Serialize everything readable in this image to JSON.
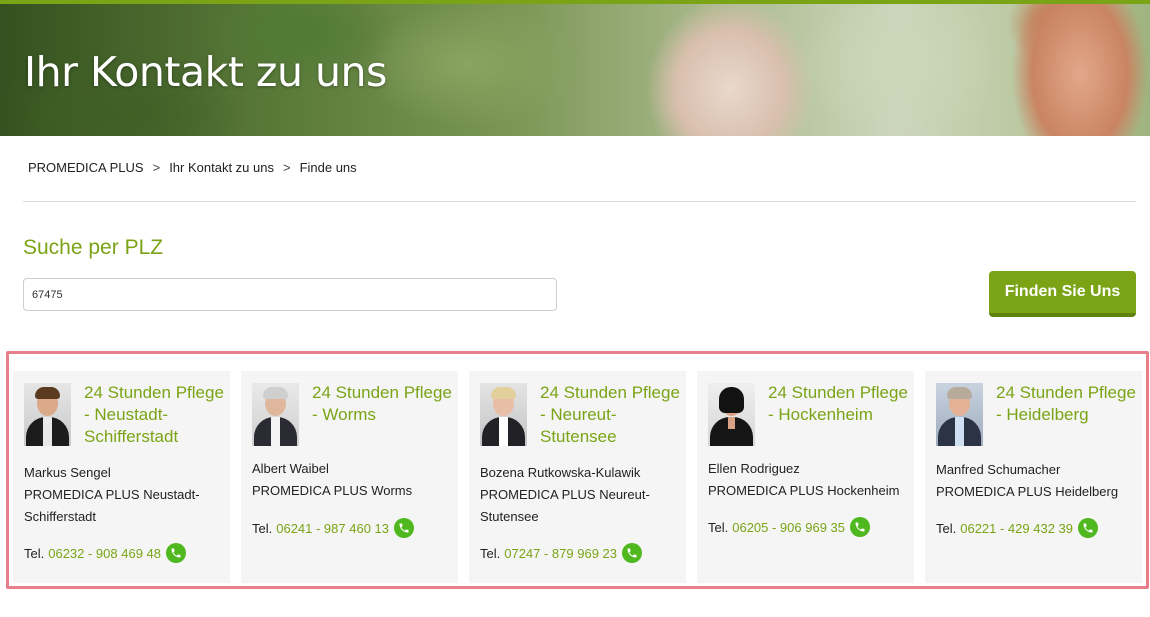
{
  "hero": {
    "title": "Ihr Kontakt zu uns"
  },
  "breadcrumb": [
    "PROMEDICA PLUS",
    "Ihr Kontakt zu uns",
    "Finde uns"
  ],
  "search": {
    "title": "Suche per PLZ",
    "value": "67475",
    "button_label": "Finden Sie Uns"
  },
  "colors": {
    "brand_green": "#7aa416",
    "phone_green": "#4fb81e",
    "highlight_border": "#e67f8a"
  },
  "contacts": [
    {
      "title": "24 Stunden Pflege - Neustadt-Schifferstadt",
      "name": "Markus Sengel",
      "company": "PROMEDICA PLUS Neustadt-Schifferstadt",
      "tel_label": "Tel.",
      "phone": "06232 - 908 469 48",
      "icon": "phone-icon"
    },
    {
      "title": "24 Stunden Pflege - Worms",
      "name": "Albert Waibel",
      "company": "PROMEDICA PLUS Worms",
      "tel_label": "Tel.",
      "phone": "06241 - 987 460 13",
      "icon": "phone-icon"
    },
    {
      "title": "24 Stunden Pflege - Neureut-Stutensee",
      "name": "Bozena Rutkowska-Kulawik",
      "company": "PROMEDICA PLUS Neureut-Stutensee",
      "tel_label": "Tel.",
      "phone": "07247 - 879 969 23",
      "icon": "phone-icon"
    },
    {
      "title": "24 Stunden Pflege - Hockenheim",
      "name": "Ellen Rodriguez",
      "company": "PROMEDICA PLUS Hockenheim",
      "tel_label": "Tel.",
      "phone": "06205 - 906 969 35",
      "icon": "phone-icon"
    },
    {
      "title": "24 Stunden Pflege - Heidelberg",
      "name": "Manfred Schumacher",
      "company": "PROMEDICA PLUS Heidelberg",
      "tel_label": "Tel.",
      "phone": "06221 - 429 432 39",
      "icon": "phone-icon"
    }
  ]
}
